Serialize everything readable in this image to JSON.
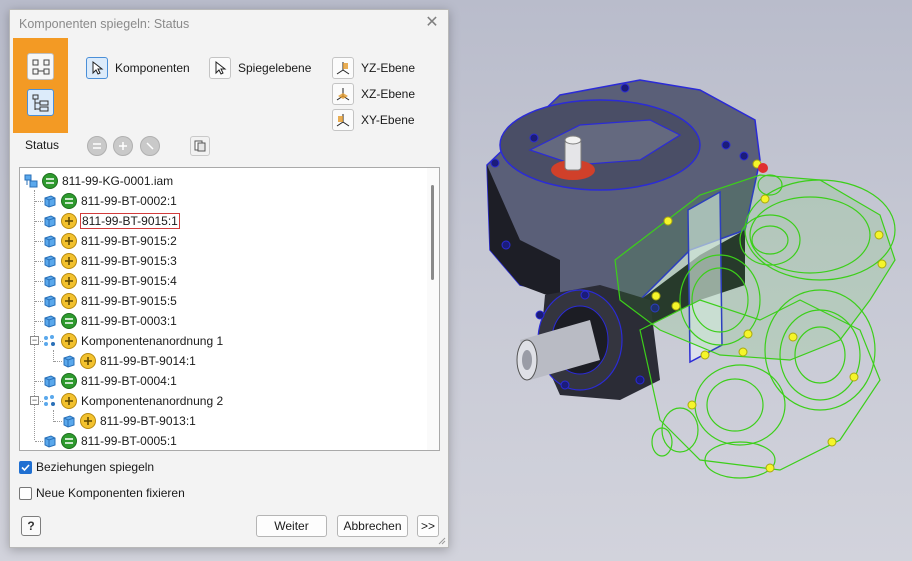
{
  "dialog": {
    "title": "Komponenten spiegeln: Status",
    "close_glyph": "✕",
    "mode_buttons": [
      {
        "icon": "components-mode-icon",
        "active": false
      },
      {
        "icon": "status-tree-icon",
        "active": true
      }
    ],
    "tools": {
      "komponenten": "Komponenten",
      "spiegelebene": "Spiegelebene",
      "yz": "YZ-Ebene",
      "xz": "XZ-Ebene",
      "xy": "XY-Ebene"
    },
    "status_label": "Status",
    "status_buttons": [
      "mirror-status-icon",
      "reuse-status-icon",
      "exclude-status-icon",
      "preview-icon"
    ]
  },
  "tree": {
    "items": [
      {
        "name": "811-99-KG-0001.iam",
        "status": "green",
        "kind": "assembly-root",
        "level": 0
      },
      {
        "name": "811-99-BT-0002:1",
        "status": "green",
        "kind": "part",
        "level": 1
      },
      {
        "name": "811-99-BT-9015:1",
        "status": "yellow",
        "kind": "part",
        "level": 1,
        "selected": true
      },
      {
        "name": "811-99-BT-9015:2",
        "status": "yellow",
        "kind": "part",
        "level": 1
      },
      {
        "name": "811-99-BT-9015:3",
        "status": "yellow",
        "kind": "part",
        "level": 1
      },
      {
        "name": "811-99-BT-9015:4",
        "status": "yellow",
        "kind": "part",
        "level": 1
      },
      {
        "name": "811-99-BT-9015:5",
        "status": "yellow",
        "kind": "part",
        "level": 1
      },
      {
        "name": "811-99-BT-0003:1",
        "status": "green",
        "kind": "part",
        "level": 1
      },
      {
        "name": "Komponentenanordnung 1",
        "status": "yellow",
        "kind": "pattern",
        "level": 1,
        "expander": "−"
      },
      {
        "name": "811-99-BT-9014:1",
        "status": "yellow",
        "kind": "part",
        "level": 2
      },
      {
        "name": "811-99-BT-0004:1",
        "status": "green",
        "kind": "part",
        "level": 1
      },
      {
        "name": "Komponentenanordnung 2",
        "status": "yellow",
        "kind": "pattern",
        "level": 1,
        "expander": "−"
      },
      {
        "name": "811-99-BT-9013:1",
        "status": "yellow",
        "kind": "part",
        "level": 2
      },
      {
        "name": "811-99-BT-0005:1",
        "status": "green",
        "kind": "part",
        "level": 1
      }
    ]
  },
  "options": {
    "beziehungen": {
      "label": "Beziehungen spiegeln",
      "checked": true
    },
    "fixieren": {
      "label": "Neue Komponenten fixieren",
      "checked": false
    }
  },
  "footer": {
    "help": "?",
    "weiter": "Weiter",
    "abbrechen": "Abbrechen",
    "more": ">>"
  },
  "colors": {
    "accent_orange": "#f39a24",
    "selection_blue": "#4a8fd8",
    "status_green": "#2e9a2e",
    "status_yellow": "#f2c12e",
    "mirror_preview_green": "#3ccf1a",
    "mirror_preview_yellow": "#f5f52a"
  }
}
